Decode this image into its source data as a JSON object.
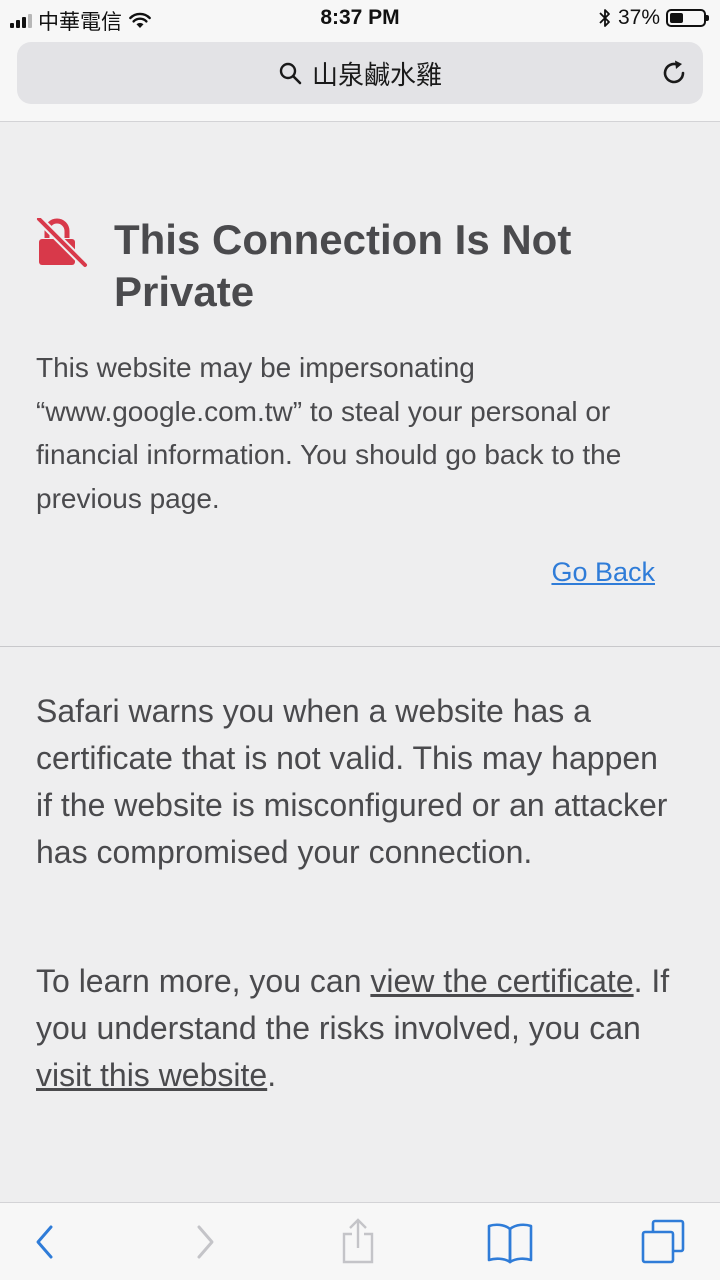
{
  "status_bar": {
    "carrier": "中華電信",
    "time": "8:37 PM",
    "battery_text": "37%",
    "battery_level": 0.37
  },
  "address_bar": {
    "query": "山泉鹹水雞",
    "icons": [
      "search-icon",
      "reload-icon"
    ]
  },
  "warning": {
    "title": "This Connection Is Not Private",
    "description": "This website may be impersonating “www.google.com.tw” to steal your personal or financial information. You should go back to the previous page.",
    "go_back_label": "Go Back",
    "accent_color": "#d8394a"
  },
  "details": {
    "paragraph1": "Safari warns you when a website has a certificate that is not valid. This may happen if the website is misconfigured or an attacker has compromised your connection.",
    "paragraph2_part1": "To learn more, you can ",
    "view_certificate_label": "view the certificate",
    "paragraph2_part2": ". If you understand the risks involved, you can ",
    "visit_website_label": "visit this website",
    "paragraph2_part3": "."
  },
  "bottom_toolbar": {
    "icons": [
      "back-icon",
      "forward-icon",
      "share-icon",
      "bookmarks-icon",
      "tabs-icon"
    ],
    "link_color": "#2f7cd8"
  }
}
